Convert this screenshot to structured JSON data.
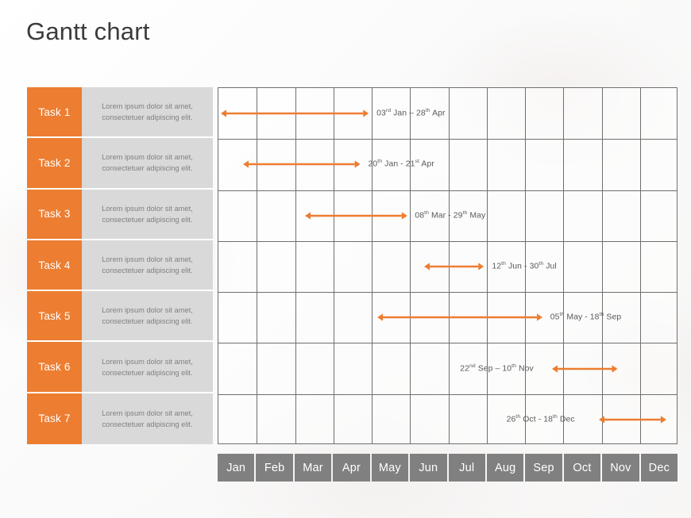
{
  "title": "Gantt chart",
  "colors": {
    "accent_orange": "#ED7D31",
    "desc_bg": "#D9D9D9",
    "desc_text": "#808080",
    "month_bar": "#808080",
    "grid_line": "#6F6F6F",
    "date_text": "#595959",
    "background": "#FBFBFB"
  },
  "chart_data": {
    "type": "bar",
    "title": "Gantt chart",
    "xlabel": "",
    "ylabel": "",
    "categories": [
      "Task 1",
      "Task 2",
      "Task 3",
      "Task 4",
      "Task 5",
      "Task 6",
      "Task 7"
    ],
    "x_tick_labels": [
      "Jan",
      "Feb",
      "Mar",
      "Apr",
      "May",
      "Jun",
      "Jul",
      "Aug",
      "Sep",
      "Oct",
      "Nov",
      "Dec"
    ],
    "xlim": [
      0,
      12
    ],
    "grid": true,
    "legend": "none",
    "tasks": [
      {
        "name": "Task 1",
        "description": "Lorem ipsum dolor sit amet, consectetuer adipiscing elit.",
        "start_label": "03rd Jan",
        "end_label": "28th Apr",
        "range_label": "03rd Jan – 28th Apr",
        "start_month_index": 0,
        "end_month_index": 3.92,
        "start_value": 0.06,
        "end_value": 3.92
      },
      {
        "name": "Task 2",
        "description": "Lorem ipsum dolor sit amet, consectetuer adipiscing elit.",
        "start_label": "20th Jan",
        "end_label": "21st Apr",
        "range_label": "20th Jan - 21st Apr",
        "start_month_index": 0.64,
        "end_month_index": 3.7,
        "start_value": 0.64,
        "end_value": 3.7
      },
      {
        "name": "Task 3",
        "description": "Lorem ipsum dolor sit amet, consectetuer adipiscing elit.",
        "start_label": "08th Mar",
        "end_label": "29th May",
        "range_label": "08th Mar - 29th May",
        "start_month_index": 2.25,
        "end_month_index": 4.92,
        "start_value": 2.25,
        "end_value": 4.92
      },
      {
        "name": "Task 4",
        "description": "Lorem ipsum dolor sit amet, consectetuer adipiscing elit.",
        "start_label": "12th Jun",
        "end_label": "30th Jul",
        "range_label": "12th Jun - 30th Jul",
        "start_month_index": 5.37,
        "end_month_index": 6.93,
        "start_value": 5.37,
        "end_value": 6.93
      },
      {
        "name": "Task 5",
        "description": "Lorem ipsum dolor sit amet, consectetuer adipiscing elit.",
        "start_label": "05th May",
        "end_label": "18th Sep",
        "range_label": "05th May - 18th Sep",
        "start_month_index": 4.14,
        "end_month_index": 8.45,
        "start_value": 4.14,
        "end_value": 8.45
      },
      {
        "name": "Task 6",
        "description": "Lorem ipsum dolor sit amet, consectetuer adipiscing elit.",
        "start_label": "22nd Sep",
        "end_label": "10th Nov",
        "range_label": "22nd Sep – 10th Nov",
        "start_month_index": 8.71,
        "end_month_index": 10.42,
        "start_value": 8.71,
        "end_value": 10.42
      },
      {
        "name": "Task 7",
        "description": "Lorem ipsum dolor sit amet, consectetuer adipiscing elit.",
        "start_label": "26th Oct",
        "end_label": "18th Dec",
        "range_label": "26th Oct - 18th Dec",
        "start_month_index": 9.92,
        "end_month_index": 11.68,
        "start_value": 9.92,
        "end_value": 11.68
      }
    ]
  },
  "months": [
    {
      "label": "Jan"
    },
    {
      "label": "Feb"
    },
    {
      "label": "Mar"
    },
    {
      "label": "Apr"
    },
    {
      "label": "May"
    },
    {
      "label": "Jun"
    },
    {
      "label": "Jul"
    },
    {
      "label": "Aug"
    },
    {
      "label": "Sep"
    },
    {
      "label": "Oct"
    },
    {
      "label": "Nov"
    },
    {
      "label": "Dec"
    }
  ],
  "date_labels": [
    {
      "start_day": "03",
      "start_ord": "rd",
      "start_month": "Jan",
      "sep": "–",
      "end_day": "28",
      "end_ord": "th",
      "end_month": "Apr"
    },
    {
      "start_day": "20",
      "start_ord": "th",
      "start_month": "Jan",
      "sep": "-",
      "end_day": "21",
      "end_ord": "st",
      "end_month": "Apr"
    },
    {
      "start_day": "08",
      "start_ord": "th",
      "start_month": "Mar",
      "sep": "-",
      "end_day": "29",
      "end_ord": "th",
      "end_month": "May"
    },
    {
      "start_day": "12",
      "start_ord": "th",
      "start_month": "Jun",
      "sep": "-",
      "end_day": "30",
      "end_ord": "th",
      "end_month": "Jul"
    },
    {
      "start_day": "05",
      "start_ord": "th",
      "start_month": "May",
      "sep": "-",
      "end_day": "18",
      "end_ord": "th",
      "end_month": "Sep"
    },
    {
      "start_day": "22",
      "start_ord": "nd",
      "start_month": "Sep",
      "sep": "–",
      "end_day": "10",
      "end_ord": "th",
      "end_month": "Nov"
    },
    {
      "start_day": "26",
      "start_ord": "th",
      "start_month": "Oct",
      "sep": "-",
      "end_day": "18",
      "end_ord": "th",
      "end_month": "Dec"
    }
  ]
}
